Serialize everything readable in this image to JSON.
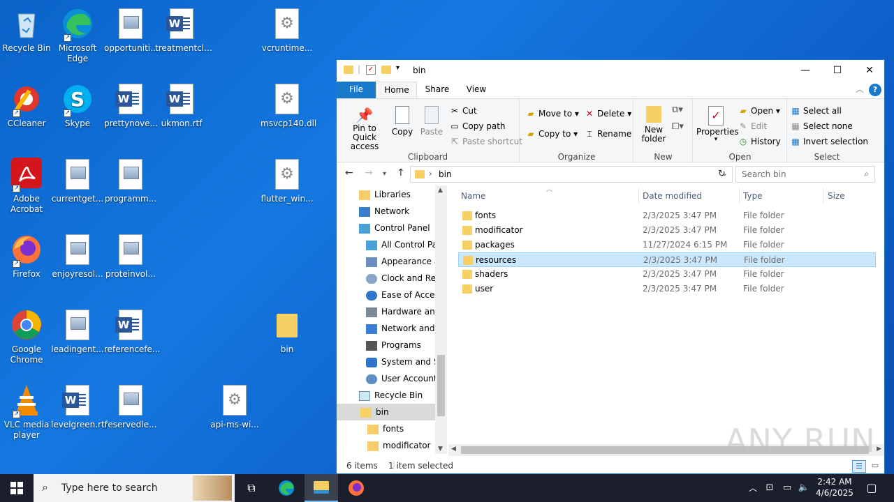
{
  "desktop": {
    "icons": [
      {
        "label": "Recycle Bin",
        "icon": "recycle-bin-icon"
      },
      {
        "label": "Microsoft Edge",
        "icon": "edge-icon"
      },
      {
        "label": "opportuniti...",
        "icon": "image-file-icon"
      },
      {
        "label": "treatmentcl...",
        "icon": "word-file-icon"
      },
      {
        "label": "vcruntime...",
        "icon": "system-file-icon"
      },
      {
        "label": "CCleaner",
        "icon": "ccleaner-icon"
      },
      {
        "label": "Skype",
        "icon": "skype-icon"
      },
      {
        "label": "prettynove...",
        "icon": "word-file-icon"
      },
      {
        "label": "ukmon.rtf",
        "icon": "word-file-icon"
      },
      {
        "label": "msvcp140.dll",
        "icon": "system-file-icon"
      },
      {
        "label": "Adobe Acrobat",
        "icon": "acrobat-icon"
      },
      {
        "label": "currentget...",
        "icon": "image-file-icon"
      },
      {
        "label": "programm...",
        "icon": "image-file-icon"
      },
      {
        "label": "flutter_win...",
        "icon": "system-file-icon"
      },
      {
        "label": "Firefox",
        "icon": "firefox-icon"
      },
      {
        "label": "enjoyresol...",
        "icon": "image-file-icon"
      },
      {
        "label": "proteinvol...",
        "icon": "image-file-icon"
      },
      {
        "label": "Google Chrome",
        "icon": "chrome-icon"
      },
      {
        "label": "leadingent...",
        "icon": "image-file-icon"
      },
      {
        "label": "referencefe...",
        "icon": "word-file-icon"
      },
      {
        "label": "bin",
        "icon": "folder-icon"
      },
      {
        "label": "VLC media player",
        "icon": "vlc-icon"
      },
      {
        "label": "levelgreen.rtf",
        "icon": "word-file-icon"
      },
      {
        "label": "reservedle...",
        "icon": "image-file-icon"
      },
      {
        "label": "api-ms-wi...",
        "icon": "system-file-icon"
      }
    ]
  },
  "explorer": {
    "title": "bin",
    "window_buttons": {
      "minimize": "—",
      "maximize": "☐",
      "close": "✕"
    },
    "tabs": [
      "File",
      "Home",
      "Share",
      "View"
    ],
    "ribbon": {
      "clipboard": {
        "pin": "Pin to Quick access",
        "copy": "Copy",
        "paste": "Paste",
        "cut": "Cut",
        "copy_path": "Copy path",
        "paste_shortcut": "Paste shortcut",
        "label": "Clipboard"
      },
      "organize": {
        "move_to": "Move to",
        "copy_to": "Copy to",
        "delete": "Delete",
        "rename": "Rename",
        "label": "Organize"
      },
      "new": {
        "new_folder": "New folder",
        "label": "New"
      },
      "open": {
        "properties": "Properties",
        "open": "Open",
        "edit": "Edit",
        "history": "History",
        "label": "Open"
      },
      "select": {
        "select_all": "Select all",
        "select_none": "Select none",
        "invert": "Invert selection",
        "label": "Select"
      }
    },
    "address": {
      "path": "bin",
      "search_placeholder": "Search bin"
    },
    "nav": [
      {
        "label": "Libraries"
      },
      {
        "label": "Network"
      },
      {
        "label": "Control Panel"
      },
      {
        "label": "All Control Par"
      },
      {
        "label": "Appearance an"
      },
      {
        "label": "Clock and Regi"
      },
      {
        "label": "Ease of Access"
      },
      {
        "label": "Hardware and"
      },
      {
        "label": "Network and Ir"
      },
      {
        "label": "Programs"
      },
      {
        "label": "System and Sec"
      },
      {
        "label": "User Accounts"
      },
      {
        "label": "Recycle Bin"
      },
      {
        "label": "bin"
      },
      {
        "label": "fonts"
      },
      {
        "label": "modificator"
      }
    ],
    "columns": {
      "name": "Name",
      "date": "Date modified",
      "type": "Type",
      "size": "Size"
    },
    "files": [
      {
        "name": "fonts",
        "date": "2/3/2025 3:47 PM",
        "type": "File folder"
      },
      {
        "name": "modificator",
        "date": "2/3/2025 3:47 PM",
        "type": "File folder"
      },
      {
        "name": "packages",
        "date": "11/27/2024 6:15 PM",
        "type": "File folder"
      },
      {
        "name": "resources",
        "date": "2/3/2025 3:47 PM",
        "type": "File folder"
      },
      {
        "name": "shaders",
        "date": "2/3/2025 3:47 PM",
        "type": "File folder"
      },
      {
        "name": "user",
        "date": "2/3/2025 3:47 PM",
        "type": "File folder"
      }
    ],
    "status": {
      "count": "6 items",
      "selected": "1 item selected"
    }
  },
  "taskbar": {
    "search_placeholder": "Type here to search",
    "time": "2:42 AM",
    "date": "4/6/2025"
  },
  "watermark": "ANY RUN",
  "colors": {
    "accent": "#1979ca",
    "selection": "#cce8ff",
    "taskbar": "#1a1f2b",
    "folder": "#f7d065"
  }
}
